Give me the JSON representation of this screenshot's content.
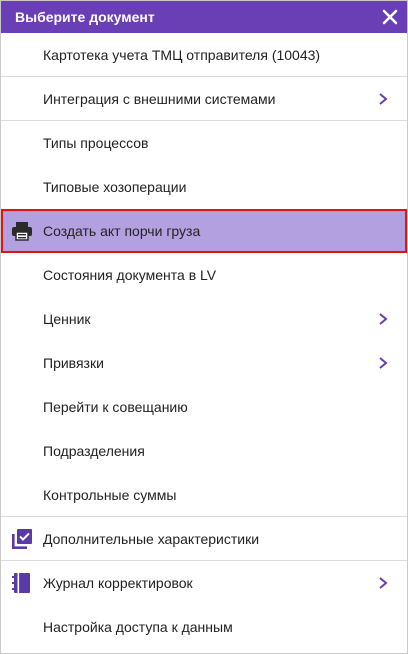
{
  "header": {
    "title": "Выберите документ",
    "close_icon": "close-icon",
    "background_color": "#6a3fb5"
  },
  "menu": {
    "items": [
      {
        "label": "Картотека учета ТМЦ отправителя (10043)",
        "icon": null,
        "has_submenu": false
      },
      {
        "label": "Интеграция с внешними системами",
        "icon": null,
        "has_submenu": true
      },
      {
        "label": "Типы процессов",
        "icon": null,
        "has_submenu": false
      },
      {
        "label": "Типовые хозоперации",
        "icon": null,
        "has_submenu": false
      },
      {
        "label": "Создать акт порчи груза",
        "icon": "printer-icon",
        "has_submenu": false,
        "highlighted": true
      },
      {
        "label": "Состояния документа в LV",
        "icon": null,
        "has_submenu": false
      },
      {
        "label": "Ценник",
        "icon": null,
        "has_submenu": true
      },
      {
        "label": "Привязки",
        "icon": null,
        "has_submenu": true
      },
      {
        "label": "Перейти к совещанию",
        "icon": null,
        "has_submenu": false
      },
      {
        "label": "Подразделения",
        "icon": null,
        "has_submenu": false
      },
      {
        "label": "Контрольные суммы",
        "icon": null,
        "has_submenu": false
      },
      {
        "label": "Дополнительные характеристики",
        "icon": "checklist-icon",
        "has_submenu": false
      },
      {
        "label": "Журнал корректировок",
        "icon": "journal-icon",
        "has_submenu": true
      },
      {
        "label": "Настройка доступа к данным",
        "icon": null,
        "has_submenu": false
      }
    ]
  },
  "colors": {
    "accent": "#6a3fb5",
    "highlight_bg": "#b3a0e0",
    "highlight_border": "#e11414"
  }
}
